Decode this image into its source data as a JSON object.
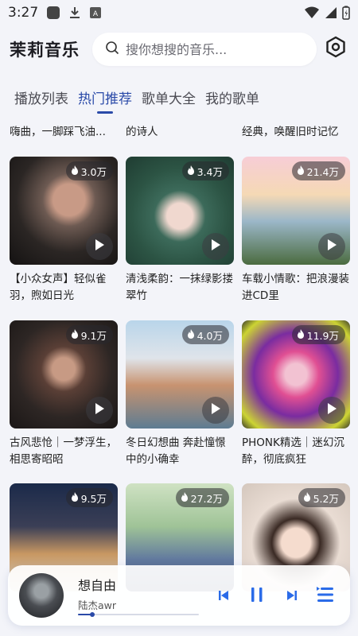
{
  "status_bar": {
    "time": "3:27"
  },
  "header": {
    "app_title": "茉莉音乐",
    "search_placeholder": "搜你想搜的音乐..."
  },
  "tabs": [
    {
      "label": "播放列表",
      "active": false
    },
    {
      "label": "热门推荐",
      "active": true
    },
    {
      "label": "歌单大全",
      "active": false
    },
    {
      "label": "我的歌单",
      "active": false
    }
  ],
  "cut_off_titles": [
    "嗨曲，一脚踩飞油...",
    "的诗人",
    "经典，唤醒旧时记忆"
  ],
  "playlists": [
    {
      "title": "【小众女声】轻似雀羽，煦如日光",
      "plays": "3.0万"
    },
    {
      "title": "清浅柔韵：一抹绿影搂翠竹",
      "plays": "3.4万"
    },
    {
      "title": "车载小情歌：把浪漫装进CD里",
      "plays": "21.4万"
    },
    {
      "title": "古风悲怆｜一梦浮生，相思寄昭昭",
      "plays": "9.1万"
    },
    {
      "title": "冬日幻想曲 奔赴憧憬中的小确幸",
      "plays": "4.0万"
    },
    {
      "title": "PHONK精选｜迷幻沉醉，彻底疯狂",
      "plays": "11.9万"
    },
    {
      "title": "",
      "plays": "9.5万"
    },
    {
      "title": "",
      "plays": "27.2万"
    },
    {
      "title": "",
      "plays": "5.2万"
    }
  ],
  "player": {
    "song_title": "想自由",
    "artist": "陆杰awr",
    "progress": 0.12
  },
  "colors": {
    "accent": "#2a4aa8",
    "background": "#f3f4f9"
  }
}
